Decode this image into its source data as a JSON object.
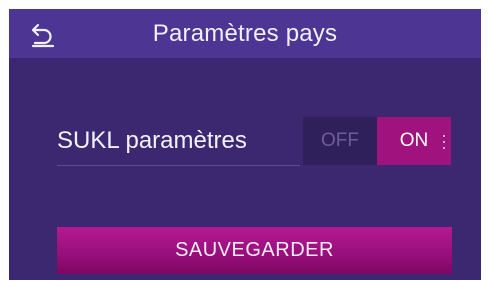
{
  "header": {
    "title": "Paramètres pays",
    "back_icon": "back-arrow-icon"
  },
  "settings": {
    "sukl": {
      "label": "SUKL paramètres",
      "off_label": "OFF",
      "on_label": "ON",
      "value": "ON",
      "grip_icon": "grip-dots-icon"
    }
  },
  "actions": {
    "save_label": "SAUVEGARDER"
  },
  "colors": {
    "background": "#3c2871",
    "header": "#4d3593",
    "toggle_off_bg": "#2f1f5a",
    "accent": "#a0137e"
  }
}
